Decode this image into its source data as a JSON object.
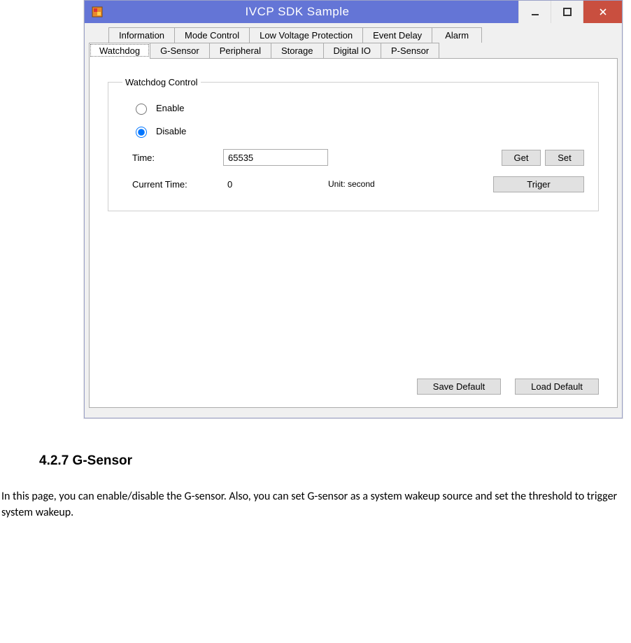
{
  "window": {
    "title": "IVCP SDK Sample"
  },
  "tabs_row1": [
    {
      "label": "Information"
    },
    {
      "label": "Mode Control"
    },
    {
      "label": "Low Voltage Protection"
    },
    {
      "label": "Event Delay"
    },
    {
      "label": "Alarm"
    }
  ],
  "tabs_row2": [
    {
      "label": "Watchdog",
      "active": true
    },
    {
      "label": "G-Sensor"
    },
    {
      "label": "Peripheral"
    },
    {
      "label": "Storage"
    },
    {
      "label": "Digital IO"
    },
    {
      "label": "P-Sensor"
    }
  ],
  "watchdog": {
    "group_title": "Watchdog Control",
    "enable_label": "Enable",
    "disable_label": "Disable",
    "time_label": "Time:",
    "time_value": "65535",
    "current_time_label": "Current Time:",
    "current_time_value": "0",
    "unit_label": "Unit: second",
    "get_label": "Get",
    "set_label": "Set",
    "trigger_label": "Triger"
  },
  "footer_buttons": {
    "save_default": "Save Default",
    "load_default": "Load Default"
  },
  "doc": {
    "heading": "4.2.7 G-Sensor",
    "body": "In this page, you can enable/disable the G-sensor. Also, you can set G-sensor as a system wakeup source and set the threshold to trigger system wakeup."
  }
}
